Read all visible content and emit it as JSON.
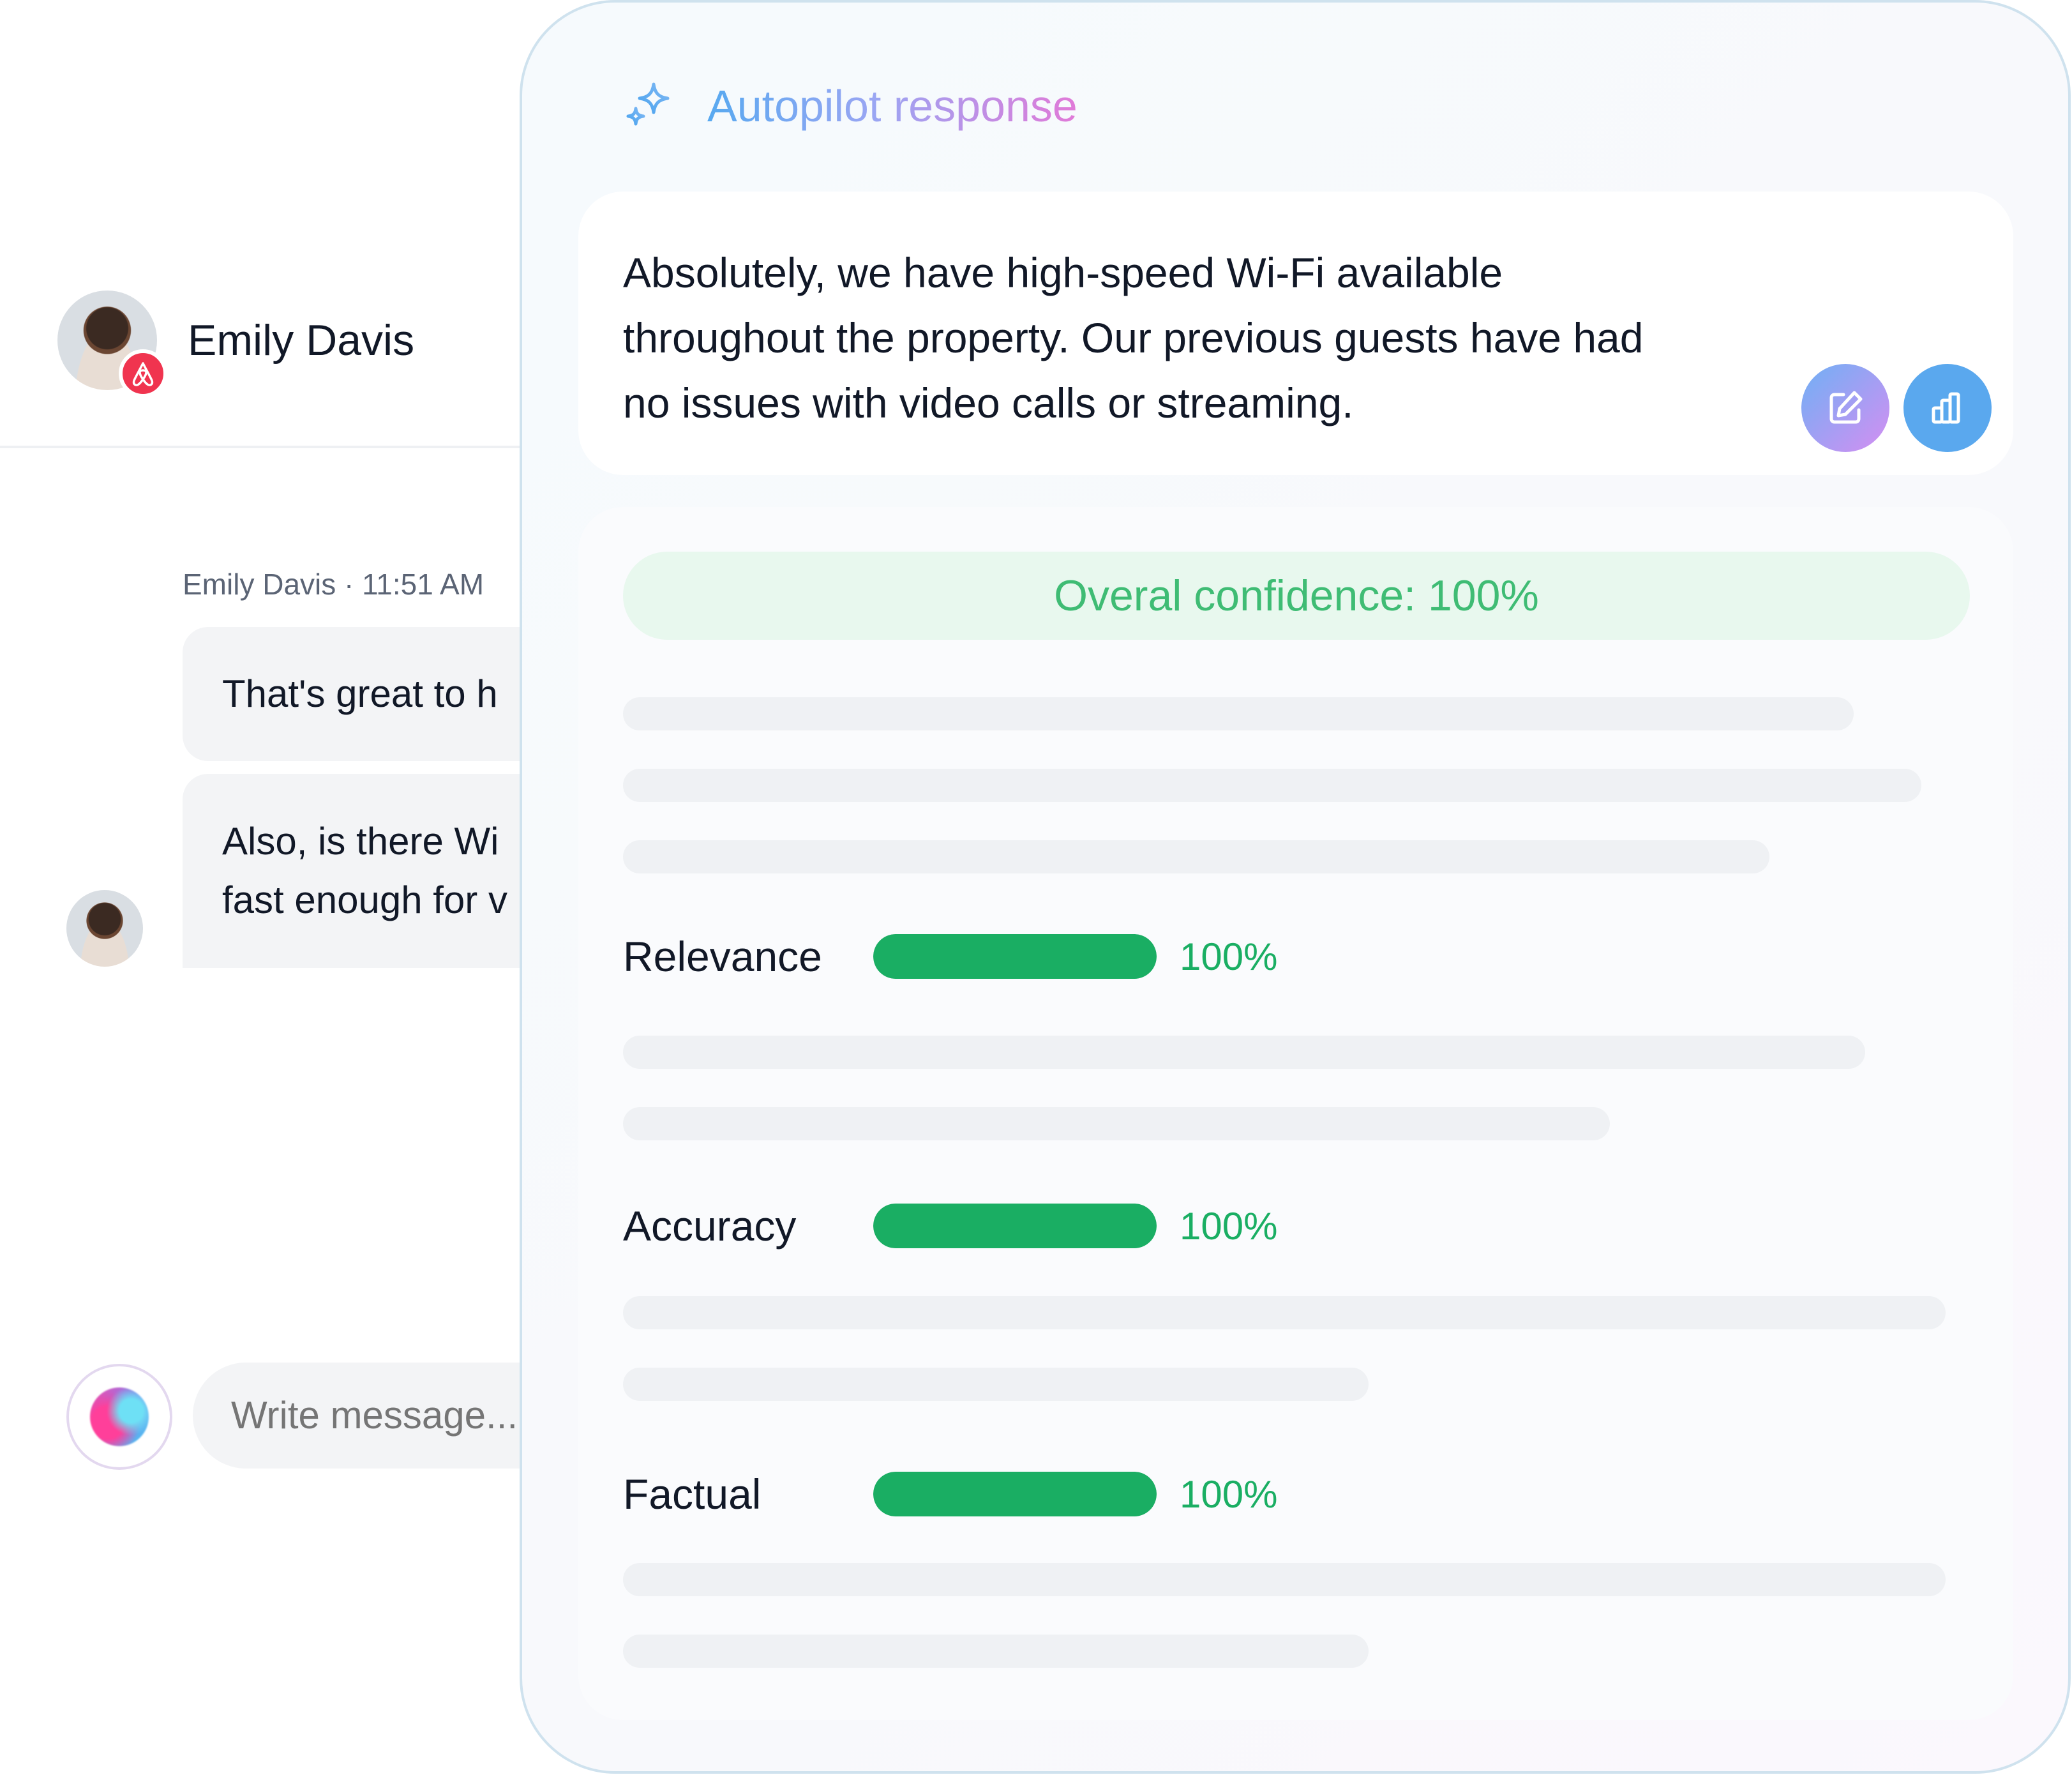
{
  "chat": {
    "contact_name": "Emily Davis",
    "message_meta": "Emily Davis · 11:51 AM",
    "messages": [
      {
        "text": "That's great to h"
      },
      {
        "line1": "Also, is there Wi",
        "line2": "fast enough for v"
      }
    ],
    "compose_placeholder": "Write message..."
  },
  "autopilot": {
    "title": "Autopilot response",
    "response_line1": "Absolutely, we have high-speed Wi-Fi available",
    "response_line2": "throughout the property. Our previous guests have had",
    "response_line3": "no issues with video calls or streaming.",
    "confidence": "Overal confidence: 100%",
    "metrics": [
      {
        "label": "Relevance",
        "value_text": "100%",
        "level": 1.0
      },
      {
        "label": "Accuracy",
        "value_text": "100%",
        "level": 1.0
      },
      {
        "label": "Factual",
        "value_text": "100%",
        "level": 1.0
      }
    ],
    "icons": {
      "header": "sparkle-icon",
      "edit": "edit-icon",
      "stats": "bar-chart-icon",
      "contact_badge": "airbnb-icon"
    }
  },
  "colors": {
    "success": "#1aae63",
    "confidence_bg": "#e8f8ee",
    "airbnb": "#f0344f",
    "accent_blue": "#5aa8ee"
  }
}
